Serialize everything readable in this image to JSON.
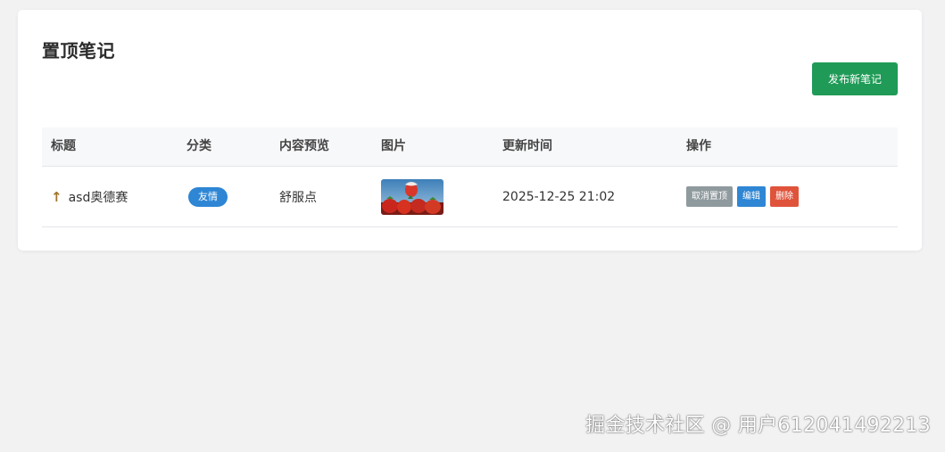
{
  "page": {
    "title": "置顶笔记",
    "publish_label": "发布新笔记"
  },
  "table": {
    "headers": [
      "标题",
      "分类",
      "内容预览",
      "图片",
      "更新时间",
      "操作"
    ],
    "rows": [
      {
        "pin_icon": "↑",
        "title": "asd奥德赛",
        "category": "友情",
        "preview": "舒服点",
        "image_icon": "strawberry-image",
        "updated": "2025-12-25 21:02",
        "actions": {
          "unpin": "取消置顶",
          "edit": "编辑",
          "delete": "删除"
        }
      }
    ]
  },
  "colors": {
    "primary_green": "#1f9b57",
    "badge_blue": "#2e86d4",
    "unpin_gray": "#8f9a9e",
    "delete_red": "#e0533b"
  },
  "watermark": "掘金技术社区 @ 用户612041492213"
}
